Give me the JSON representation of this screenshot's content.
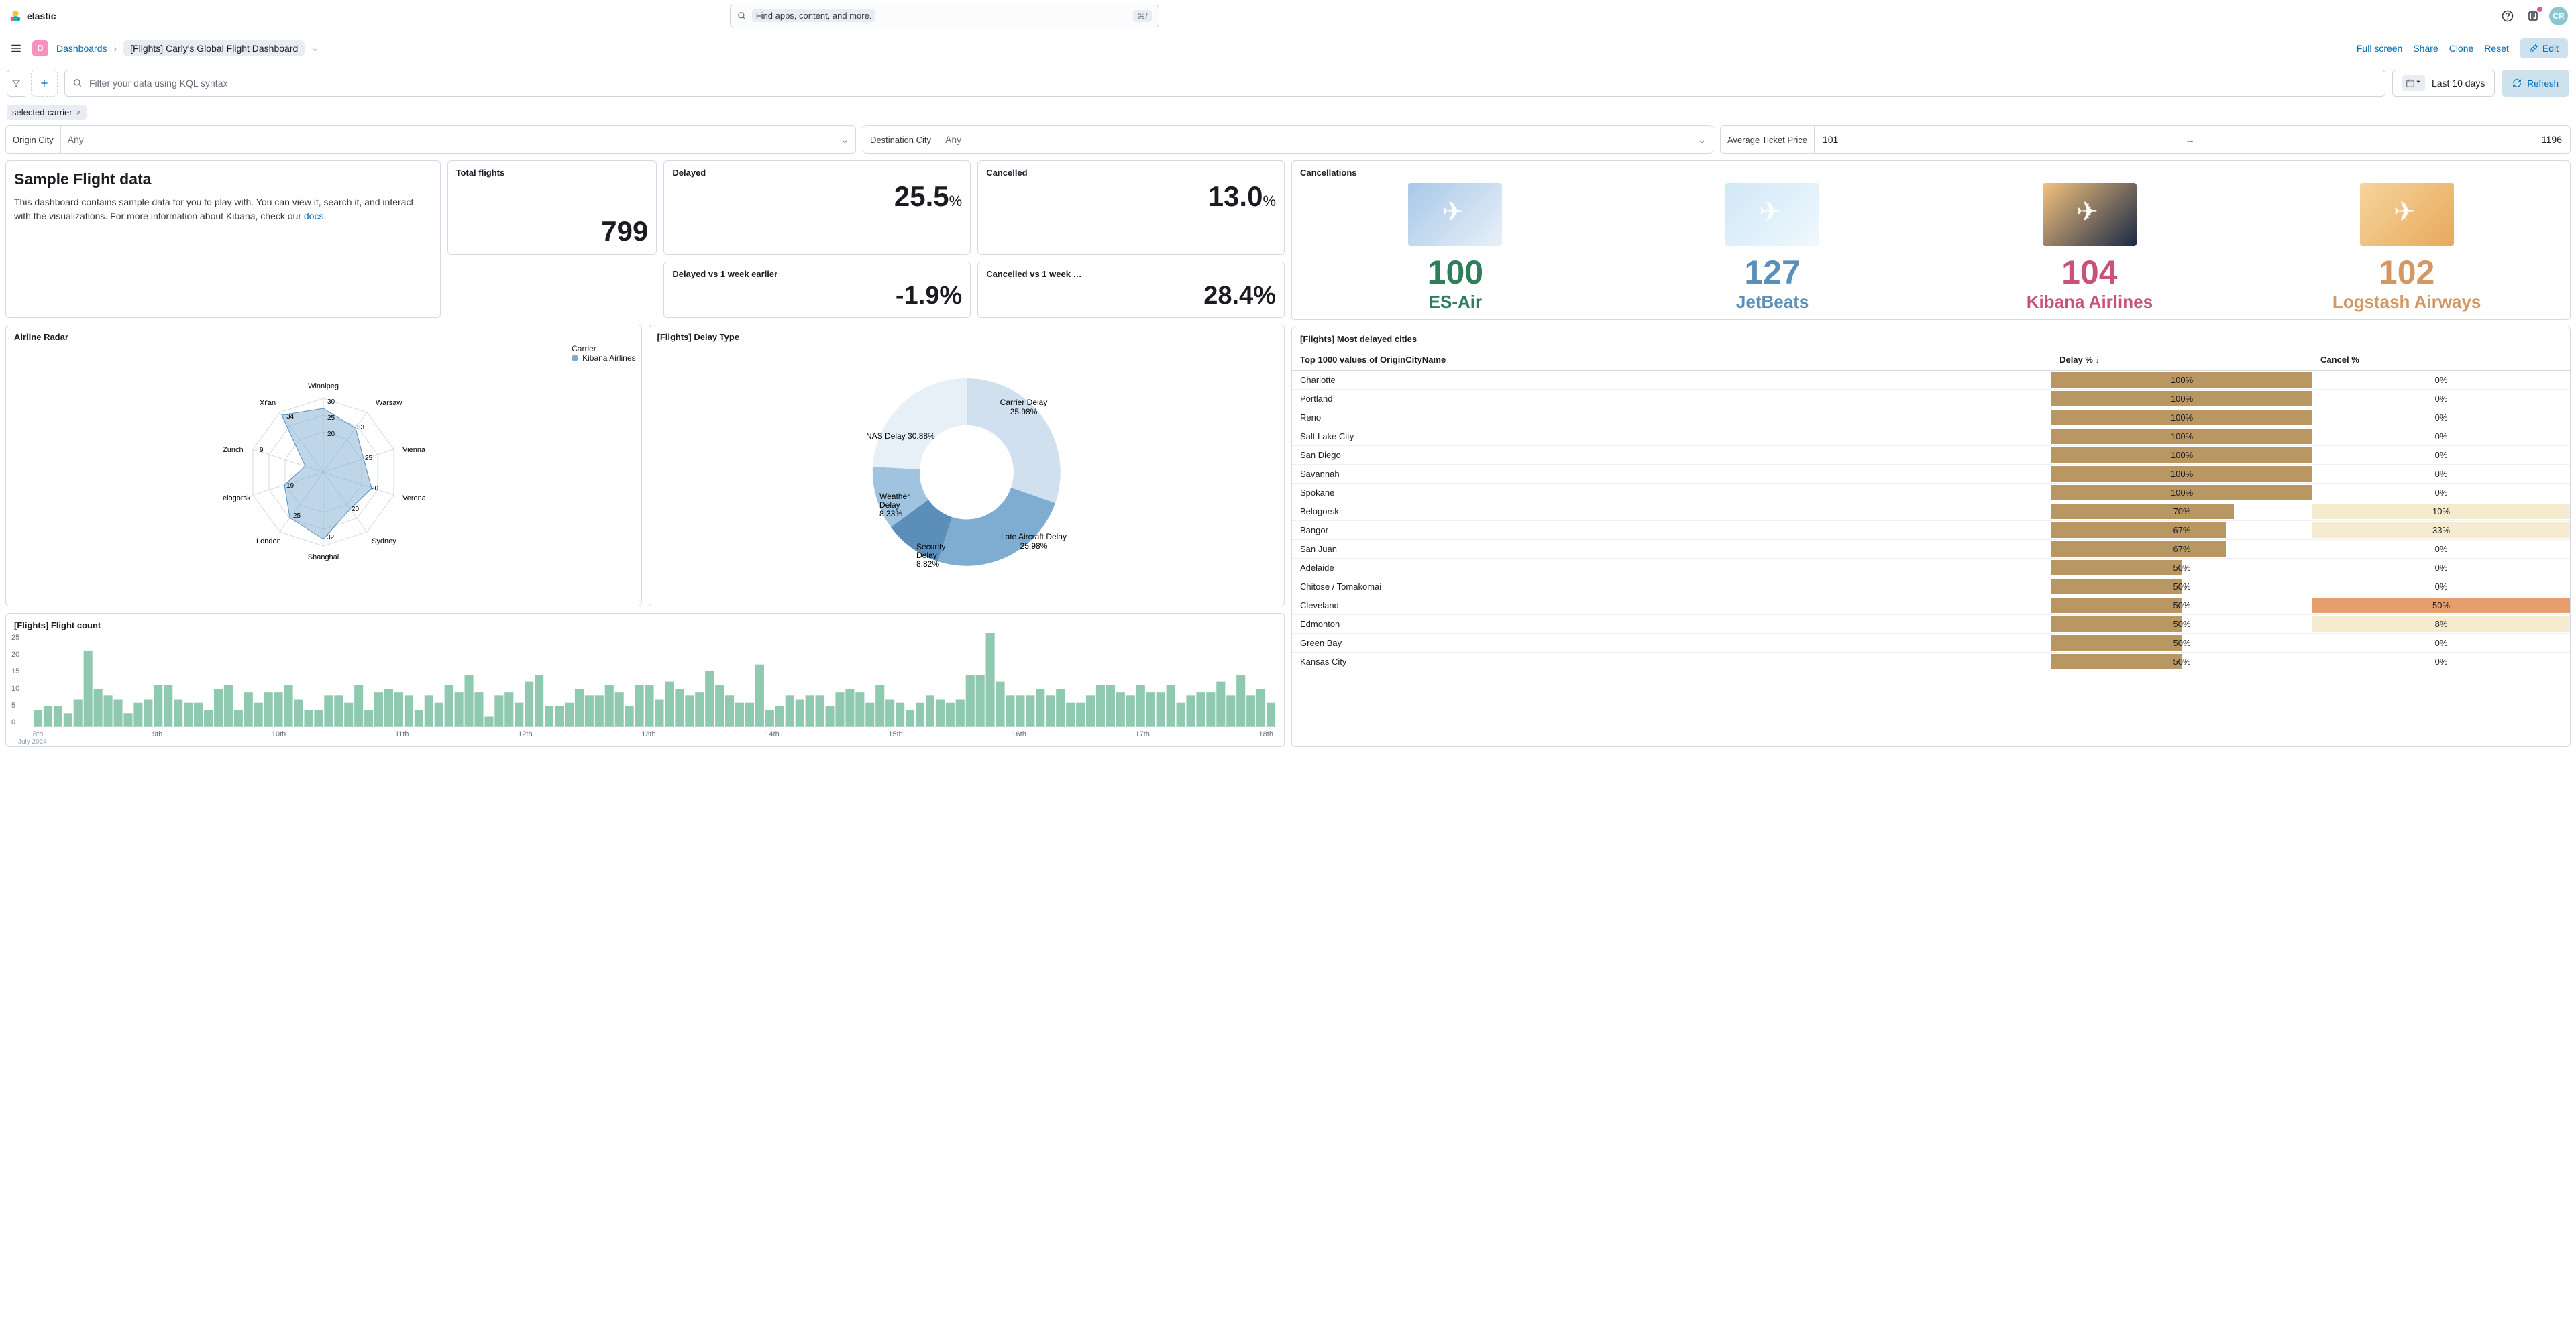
{
  "top": {
    "brand": "elastic",
    "search_placeholder": "Find apps, content, and more.",
    "kbd": "⌘/",
    "avatar": "CR"
  },
  "breadcrumb": {
    "badge": "D",
    "link1": "Dashboards",
    "crumb2": "[Flights] Carly's Global Flight Dashboard",
    "full_screen": "Full screen",
    "share": "Share",
    "clone": "Clone",
    "reset": "Reset",
    "edit": "Edit"
  },
  "query": {
    "kql_placeholder": "Filter your data using KQL syntax",
    "date_label": "Last 10 days",
    "refresh": "Refresh"
  },
  "chip": {
    "label": "selected-carrier"
  },
  "controls": {
    "origin_label": "Origin City",
    "origin_val": "Any",
    "dest_label": "Destination City",
    "dest_val": "Any",
    "price_label": "Average Ticket Price",
    "price_lo": "101",
    "price_hi": "1196"
  },
  "sample": {
    "title": "Sample Flight data",
    "body": "This dashboard contains sample data for you to play with. You can view it, search it, and interact with the visualizations. For more information about Kibana, check our ",
    "link": "docs"
  },
  "metrics": {
    "total_label": "Total flights",
    "total_val": "799",
    "delayed_label": "Delayed",
    "delayed_val": "25.5",
    "delayed_pct": "%",
    "cancelled_label": "Cancelled",
    "cancelled_val": "13.0",
    "cancelled_pct": "%",
    "dvs_label": "Delayed vs 1 week earlier",
    "dvs_val": "-1.9",
    "dvs_pct": "%",
    "cvs_label": "Cancelled vs 1 week …",
    "cvs_val": "28.4",
    "cvs_pct": "%"
  },
  "radar": {
    "title": "Airline Radar",
    "legend_title": "Carrier",
    "legend_item": "Kibana Airlines",
    "labels": [
      "Winnipeg",
      "Warsaw",
      "Vienna",
      "Verona",
      "Sydney",
      "Shanghai",
      "London",
      "elogorsk",
      "Zurich",
      "Xi'an"
    ],
    "ticks": [
      "30",
      "25",
      "20",
      "19",
      "20",
      "25",
      "32",
      "20",
      "9",
      "34"
    ]
  },
  "delay_type": {
    "title": "[Flights] Delay Type",
    "segments": [
      {
        "label": "NAS Delay",
        "pct": "30.88%"
      },
      {
        "label": "Carrier Delay",
        "pct": "25.98%"
      },
      {
        "label": "Late Aircraft Delay",
        "pct": "25.98%"
      },
      {
        "label": "Security Delay",
        "pct": "8.82%"
      },
      {
        "label": "Weather Delay",
        "pct": "8.33%"
      }
    ]
  },
  "cancellations": {
    "title": "Cancellations",
    "items": [
      {
        "num": "100",
        "name": "ES-Air"
      },
      {
        "num": "127",
        "name": "JetBeats"
      },
      {
        "num": "104",
        "name": "Kibana Airlines"
      },
      {
        "num": "102",
        "name": "Logstash Airways"
      }
    ]
  },
  "table": {
    "title": "[Flights] Most delayed cities",
    "col1": "Top 1000 values of OriginCityName",
    "col2": "Delay %",
    "col3": "Cancel %",
    "rows": [
      {
        "city": "Charlotte",
        "delay": "100%",
        "cancel": "0%",
        "dw": 100,
        "cw": 0
      },
      {
        "city": "Portland",
        "delay": "100%",
        "cancel": "0%",
        "dw": 100,
        "cw": 0
      },
      {
        "city": "Reno",
        "delay": "100%",
        "cancel": "0%",
        "dw": 100,
        "cw": 0
      },
      {
        "city": "Salt Lake City",
        "delay": "100%",
        "cancel": "0%",
        "dw": 100,
        "cw": 0
      },
      {
        "city": "San Diego",
        "delay": "100%",
        "cancel": "0%",
        "dw": 100,
        "cw": 0
      },
      {
        "city": "Savannah",
        "delay": "100%",
        "cancel": "0%",
        "dw": 100,
        "cw": 0
      },
      {
        "city": "Spokane",
        "delay": "100%",
        "cancel": "0%",
        "dw": 100,
        "cw": 0
      },
      {
        "city": "Belogorsk",
        "delay": "70%",
        "cancel": "10%",
        "dw": 70,
        "cw": 10
      },
      {
        "city": "Bangor",
        "delay": "67%",
        "cancel": "33%",
        "dw": 67,
        "cw": 33
      },
      {
        "city": "San Juan",
        "delay": "67%",
        "cancel": "0%",
        "dw": 67,
        "cw": 0
      },
      {
        "city": "Adelaide",
        "delay": "50%",
        "cancel": "0%",
        "dw": 50,
        "cw": 0
      },
      {
        "city": "Chitose / Tomakomai",
        "delay": "50%",
        "cancel": "0%",
        "dw": 50,
        "cw": 0
      },
      {
        "city": "Cleveland",
        "delay": "50%",
        "cancel": "50%",
        "dw": 50,
        "cw": 50
      },
      {
        "city": "Edmonton",
        "delay": "50%",
        "cancel": "8%",
        "dw": 50,
        "cw": 8
      },
      {
        "city": "Green Bay",
        "delay": "50%",
        "cancel": "0%",
        "dw": 50,
        "cw": 0
      },
      {
        "city": "Kansas City",
        "delay": "50%",
        "cancel": "0%",
        "dw": 50,
        "cw": 0
      }
    ]
  },
  "flight_count": {
    "title": "[Flights] Flight count",
    "y_ticks": [
      "25",
      "20",
      "15",
      "10",
      "5",
      "0"
    ],
    "x_ticks": [
      "8th",
      "9th",
      "10th",
      "11th",
      "12th",
      "13th",
      "14th",
      "15th",
      "16th",
      "17th",
      "18th"
    ],
    "x_sub": "July 2024"
  },
  "chart_data": [
    {
      "type": "radar",
      "title": "Airline Radar",
      "categories": [
        "Winnipeg",
        "Warsaw",
        "Vienna",
        "Verona",
        "Sydney",
        "Shanghai",
        "London",
        "elogorsk",
        "Zurich",
        "Xi'an"
      ],
      "series": [
        {
          "name": "Kibana Airlines",
          "values": [
            30,
            25,
            20,
            25,
            20,
            32,
            25,
            19,
            9,
            34
          ]
        }
      ],
      "ring_ticks": [
        30,
        25,
        20
      ]
    },
    {
      "type": "pie",
      "title": "[Flights] Delay Type",
      "categories": [
        "NAS Delay",
        "Carrier Delay",
        "Late Aircraft Delay",
        "Security Delay",
        "Weather Delay"
      ],
      "values": [
        30.88,
        25.98,
        25.98,
        8.82,
        8.33
      ]
    },
    {
      "type": "bar",
      "title": "[Flights] Flight count",
      "x_range": [
        "2024-07-08",
        "2024-07-18"
      ],
      "ylim": [
        0,
        25
      ],
      "note": "hourly bars; values approximate 2–23 range",
      "values": [
        5,
        6,
        6,
        4,
        8,
        22,
        11,
        9,
        8,
        4,
        7,
        8,
        12,
        12,
        8,
        7,
        7,
        5,
        11,
        12,
        5,
        10,
        7,
        10,
        10,
        12,
        8,
        5,
        5,
        9,
        9,
        7,
        12,
        5,
        10,
        11,
        10,
        9,
        5,
        9,
        7,
        12,
        10,
        15,
        10,
        3,
        9,
        10,
        7,
        13,
        15,
        6,
        6,
        7,
        11,
        9,
        9,
        12,
        10,
        6,
        12,
        12,
        8,
        13,
        11,
        9,
        10,
        16,
        12,
        9,
        7,
        7,
        18,
        5,
        6,
        9,
        8,
        9,
        9,
        6,
        10,
        11,
        10,
        7,
        12,
        8,
        7,
        5,
        7,
        9,
        8,
        7,
        8,
        15,
        15,
        27,
        13,
        9,
        9,
        9,
        11,
        9,
        11,
        7,
        7,
        9,
        12,
        12,
        10,
        9,
        12,
        10,
        10,
        12,
        7,
        9,
        10,
        10,
        13,
        9,
        15,
        9,
        11,
        7
      ]
    },
    {
      "type": "table",
      "title": "[Flights] Most delayed cities",
      "columns": [
        "OriginCityName",
        "Delay %",
        "Cancel %"
      ],
      "rows": [
        [
          "Charlotte",
          100,
          0
        ],
        [
          "Portland",
          100,
          0
        ],
        [
          "Reno",
          100,
          0
        ],
        [
          "Salt Lake City",
          100,
          0
        ],
        [
          "San Diego",
          100,
          0
        ],
        [
          "Savannah",
          100,
          0
        ],
        [
          "Spokane",
          100,
          0
        ],
        [
          "Belogorsk",
          70,
          10
        ],
        [
          "Bangor",
          67,
          33
        ],
        [
          "San Juan",
          67,
          0
        ],
        [
          "Adelaide",
          50,
          0
        ],
        [
          "Chitose / Tomakomai",
          50,
          0
        ],
        [
          "Cleveland",
          50,
          50
        ],
        [
          "Edmonton",
          50,
          8
        ],
        [
          "Green Bay",
          50,
          0
        ],
        [
          "Kansas City",
          50,
          0
        ]
      ]
    }
  ]
}
